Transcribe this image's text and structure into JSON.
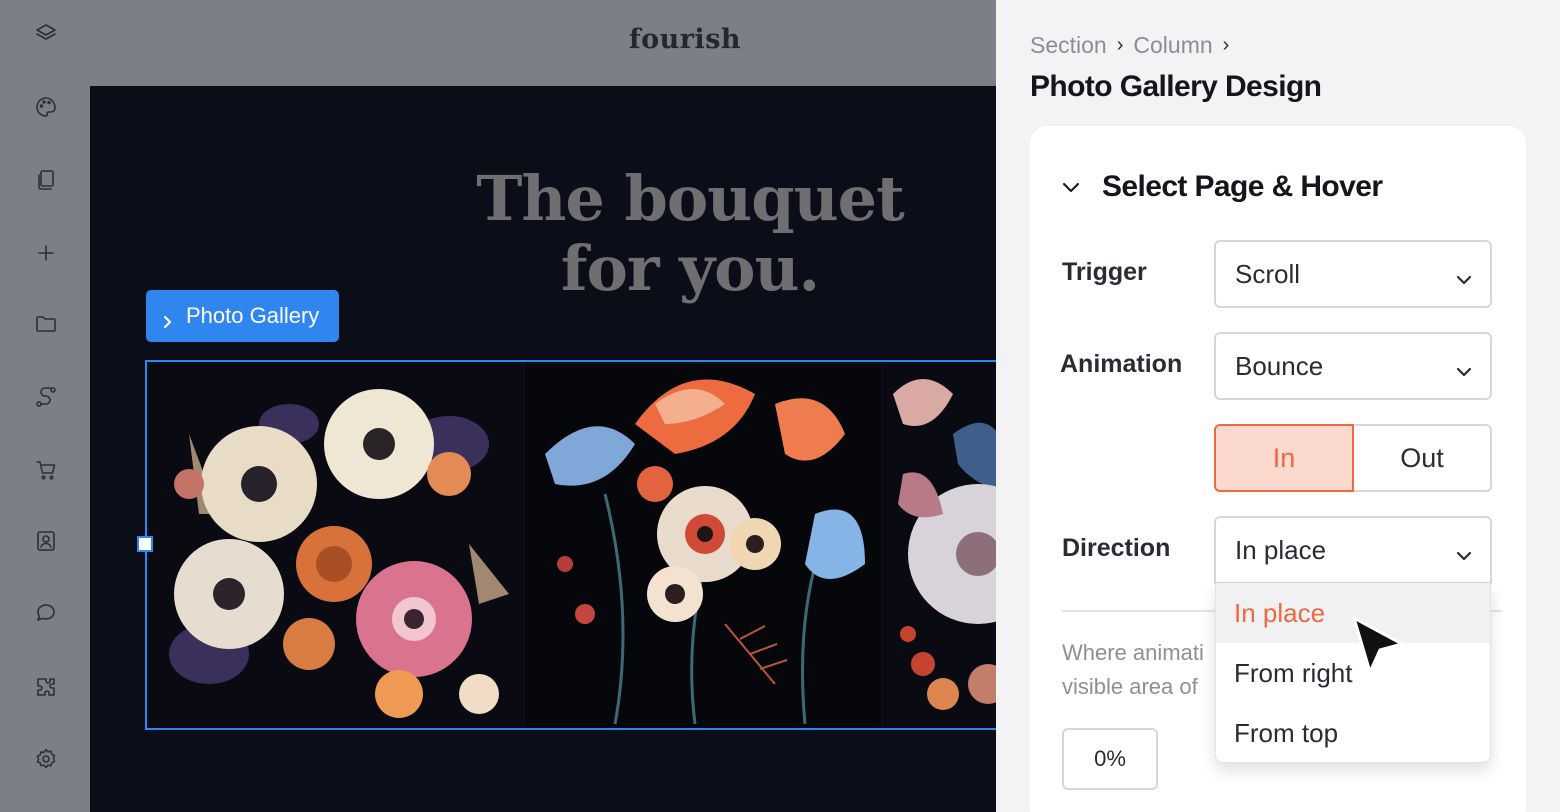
{
  "app": {
    "logo": "fourish"
  },
  "rail": {
    "icons": [
      "layers-icon",
      "palette-icon",
      "pages-icon",
      "add-icon",
      "folder-icon",
      "path-icon",
      "cart-icon",
      "contact-icon",
      "chat-icon",
      "plugin-icon",
      "settings-icon"
    ]
  },
  "canvas": {
    "headline_line1": "The bouquet",
    "headline_line2": "for you.",
    "element_tag": "Photo Gallery"
  },
  "panel": {
    "breadcrumb": [
      "Section",
      "Column"
    ],
    "title": "Photo Gallery Design",
    "section_title": "Select Page & Hover",
    "trigger": {
      "label": "Trigger",
      "value": "Scroll"
    },
    "animation": {
      "label": "Animation",
      "value": "Bounce"
    },
    "toggle": {
      "in": "In",
      "out": "Out",
      "selected": "In"
    },
    "direction": {
      "label": "Direction",
      "value": "In place",
      "options": [
        "In place",
        "From right",
        "From top"
      ],
      "highlighted": "In place"
    },
    "helper_line1": "Where animati",
    "helper_line2": "visible area of",
    "offset_value": "0%"
  },
  "colors": {
    "accent": "#ee6940",
    "selection": "#2f86ef",
    "canvas_bg": "#0b0e18"
  }
}
